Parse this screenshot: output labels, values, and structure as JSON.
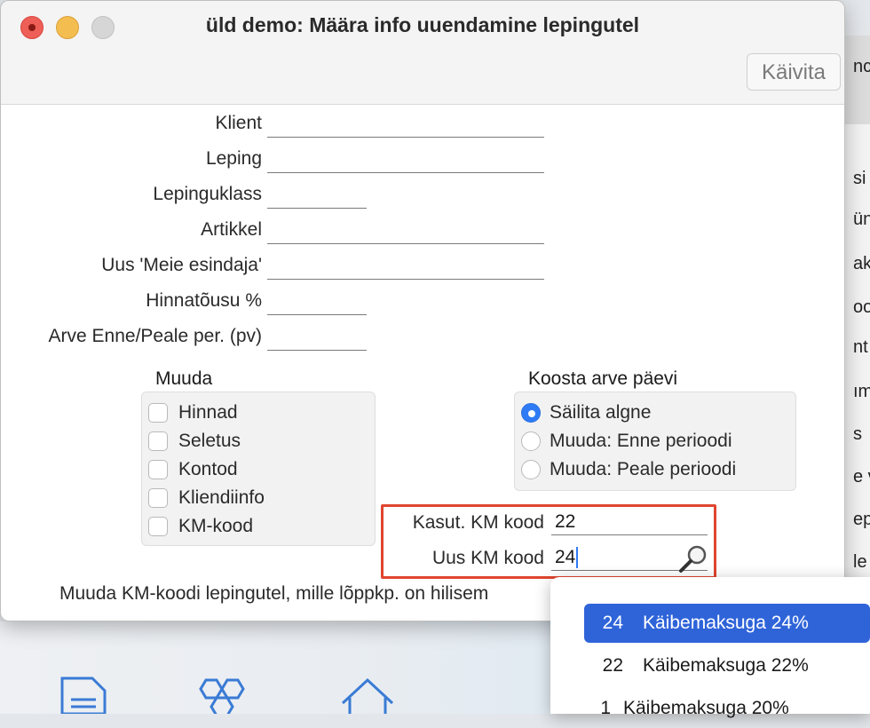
{
  "window": {
    "title": "üld demo: Määra info uuendamine lepingutel",
    "run_button": "Käivita"
  },
  "form": {
    "labels": {
      "client": "Klient",
      "contract": "Leping",
      "contract_class": "Lepinguklass",
      "item": "Artikkel",
      "new_rep": "Uus 'Meie esindaja'",
      "price_increase": "Hinnatõusu %",
      "invoice_period": "Arve Enne/Peale per. (pv)"
    },
    "values": {
      "client": "",
      "contract": "",
      "contract_class": "",
      "item": "",
      "new_rep": "",
      "price_increase": "",
      "invoice_period": ""
    }
  },
  "change_group": {
    "title": "Muuda",
    "options": [
      "Hinnad",
      "Seletus",
      "Kontod",
      "Kliendiinfo",
      "KM-kood"
    ],
    "checked": [
      false,
      false,
      false,
      false,
      false
    ]
  },
  "invoice_day_group": {
    "title": "Koosta arve päevi",
    "options": [
      "Säilita algne",
      "Muuda: Enne perioodi",
      "Muuda: Peale perioodi"
    ],
    "selected_index": 0
  },
  "vat": {
    "used_label": "Kasut. KM kood",
    "used_value": "22",
    "new_label": "Uus KM kood",
    "new_value": "24"
  },
  "footer_text": "Muuda KM-koodi lepingutel, mille lõppkp. on hilisem",
  "dropdown": {
    "items": [
      {
        "code": "24",
        "label": "Käibemaksuga 24%"
      },
      {
        "code": "22",
        "label": "Käibemaksuga 22%"
      },
      {
        "code": "1",
        "label": "Käibemaksuga 20%"
      }
    ],
    "selected_index": 0
  },
  "background": {
    "right_fragments": [
      "nc",
      "si",
      "ün",
      "ak",
      "oo",
      "nt",
      "ım",
      "s",
      "e v",
      "ep",
      "le"
    ]
  },
  "colors": {
    "accent": "#2f64d9",
    "highlight_border": "#e0452f",
    "radio_on": "#2f7bf5"
  }
}
